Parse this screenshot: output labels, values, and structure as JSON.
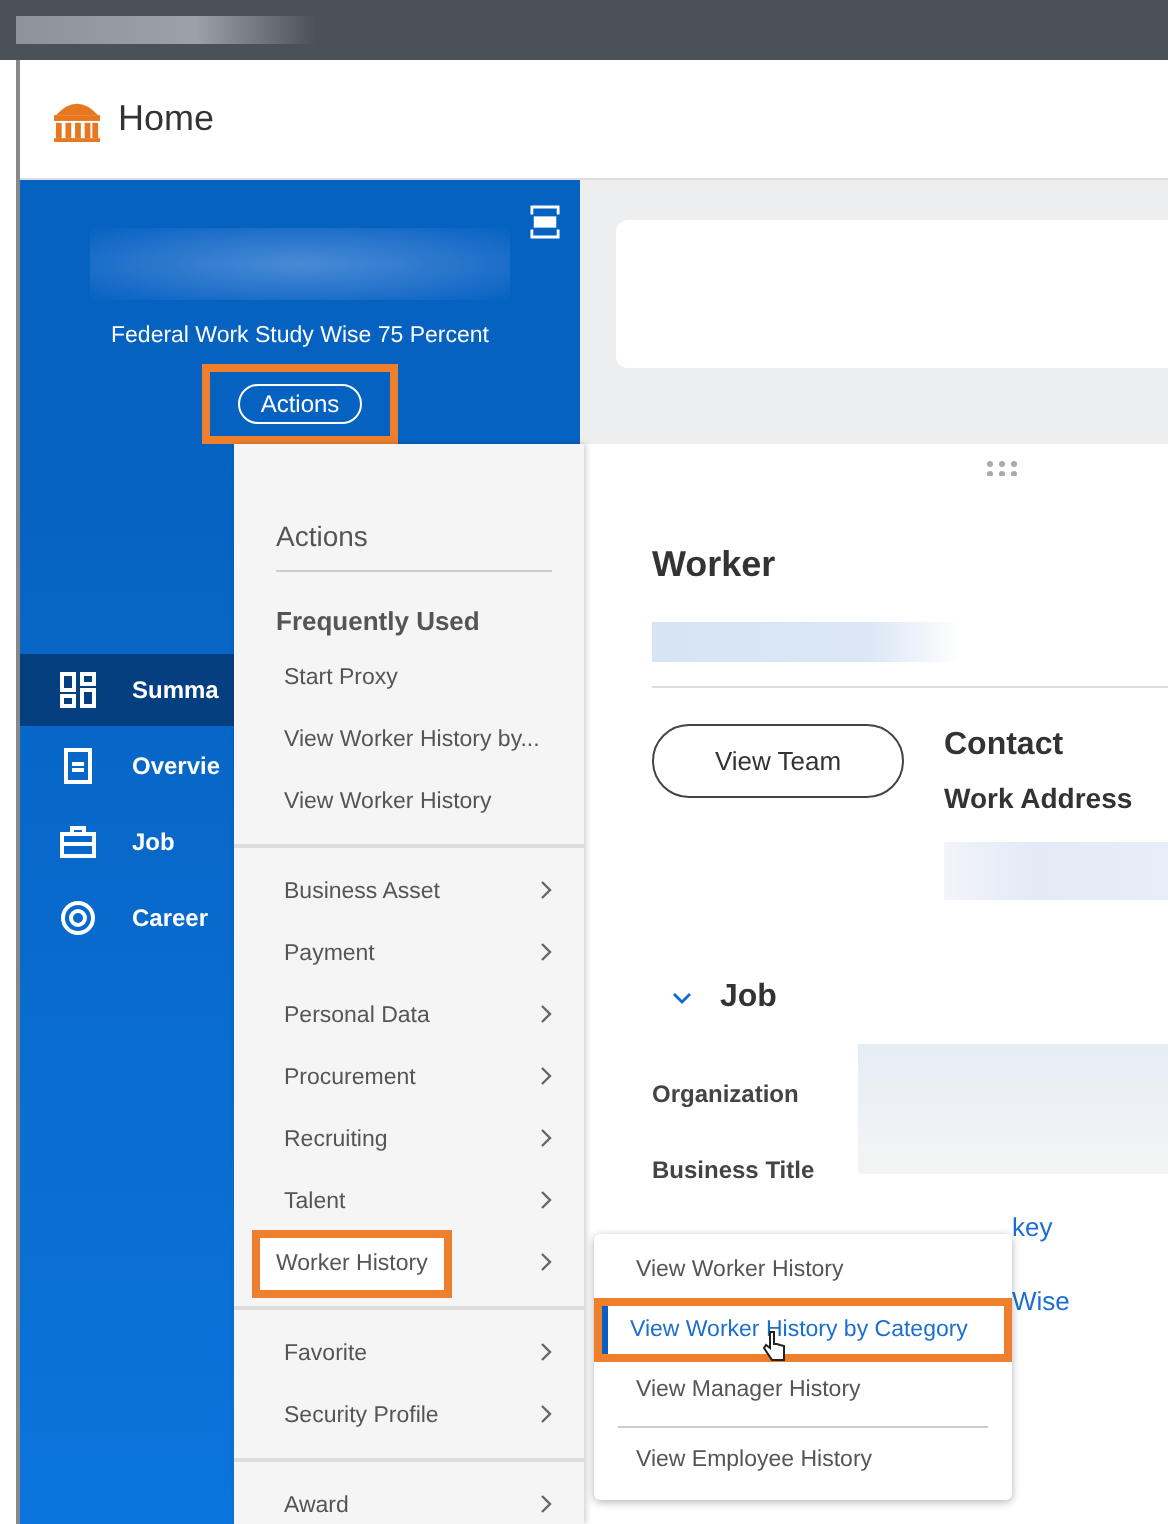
{
  "header": {
    "title": "Home"
  },
  "profile": {
    "subtitle": "Federal Work Study Wise 75 Percent",
    "actions_button": {
      "label": "Actions",
      "highlighted": true
    }
  },
  "sidebar": {
    "items": [
      {
        "label": "Summa",
        "kind": "grid",
        "selected": true
      },
      {
        "label": "Overvie",
        "kind": "document",
        "selected": false
      },
      {
        "label": "Job",
        "kind": "briefcase",
        "selected": false
      },
      {
        "label": "Career",
        "kind": "target",
        "selected": false
      }
    ]
  },
  "worker": {
    "title": "Worker",
    "button": "View Team",
    "contact_title": "Contact",
    "work_address_label": "Work Address"
  },
  "job_section": {
    "title": "Job",
    "expanded": true,
    "fields": [
      "Organization",
      "Business Title"
    ],
    "links": [
      "key",
      "Wise"
    ]
  },
  "actions_menu": {
    "title": "Actions",
    "sections": [
      {
        "heading": "Frequently Used",
        "items": [
          {
            "label": "Start Proxy",
            "has_submenu": false,
            "highlighted": false
          },
          {
            "label": "View Worker History by...",
            "has_submenu": false,
            "highlighted": false
          },
          {
            "label": "View Worker History",
            "has_submenu": false,
            "highlighted": false
          }
        ]
      },
      {
        "items": [
          {
            "label": "Business Asset",
            "has_submenu": true,
            "highlighted": false
          },
          {
            "label": "Payment",
            "has_submenu": true,
            "highlighted": false
          },
          {
            "label": "Personal Data",
            "has_submenu": true,
            "highlighted": false
          },
          {
            "label": "Procurement",
            "has_submenu": true,
            "highlighted": false
          },
          {
            "label": "Recruiting",
            "has_submenu": true,
            "highlighted": false
          },
          {
            "label": "Talent",
            "has_submenu": true,
            "highlighted": false
          },
          {
            "label": "Worker History",
            "has_submenu": true,
            "highlighted": true
          }
        ]
      },
      {
        "items": [
          {
            "label": "Favorite",
            "has_submenu": true,
            "highlighted": false
          },
          {
            "label": "Security Profile",
            "has_submenu": true,
            "highlighted": false
          }
        ]
      },
      {
        "items": [
          {
            "label": "Award",
            "has_submenu": true,
            "highlighted": false
          }
        ]
      }
    ]
  },
  "submenu": {
    "groups": [
      [
        {
          "label": "View Worker History",
          "selected": false,
          "highlighted": false
        },
        {
          "label": "View Worker History by Category",
          "selected": true,
          "highlighted": true
        },
        {
          "label": "View Manager History",
          "selected": false,
          "highlighted": false
        }
      ],
      [
        {
          "label": "View Employee History",
          "selected": false,
          "highlighted": false
        }
      ]
    ]
  }
}
